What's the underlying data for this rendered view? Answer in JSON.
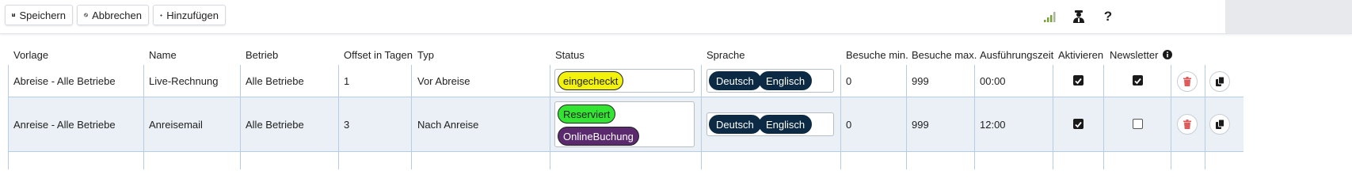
{
  "toolbar": {
    "save_label": "Speichern",
    "cancel_label": "Abbrechen",
    "add_label": "Hinzufügen",
    "icons": [
      "signal-bars-icon",
      "user-agent-icon",
      "help-icon"
    ],
    "signal_color": "#7aa23a"
  },
  "table": {
    "headers": {
      "vorlage": "Vorlage",
      "name": "Name",
      "betrieb": "Betrieb",
      "offset": "Offset in Tagen",
      "typ": "Typ",
      "status": "Status",
      "sprache": "Sprache",
      "besuche_min": "Besuche min.",
      "besuche_max": "Besuche max.",
      "ausfuehrungszeit": "Ausführungszeit",
      "aktivieren": "Aktivieren",
      "newsletter": "Newsletter"
    },
    "rows": [
      {
        "vorlage": "Abreise - Alle Betriebe",
        "name": "Live-Rechnung",
        "betrieb": "Alle Betriebe",
        "offset": "1",
        "typ": "Vor Abreise",
        "status": [
          "eingecheckt"
        ],
        "sprache": [
          "Deutsch",
          "Englisch"
        ],
        "besuche_min": "0",
        "besuche_max": "999",
        "ausfuehrungszeit": "00:00",
        "aktivieren": true,
        "newsletter": true
      },
      {
        "vorlage": "Anreise - Alle Betriebe",
        "name": "Anreisemail",
        "betrieb": "Alle Betriebe",
        "offset": "3",
        "typ": "Nach Anreise",
        "status": [
          "Reserviert",
          "OnlineBuchung"
        ],
        "sprache": [
          "Deutsch",
          "Englisch"
        ],
        "besuche_min": "0",
        "besuche_max": "999",
        "ausfuehrungszeit": "12:00",
        "aktivieren": true,
        "newsletter": false
      }
    ]
  },
  "colors": {
    "status_eingecheckt": "#f2f20c",
    "status_reserviert": "#33e433",
    "status_onlinebuchung": "#5b2a6e",
    "language_pill": "#0c2a43",
    "delete_icon": "#e05a5a",
    "row_alt": "#eaf0f6"
  }
}
